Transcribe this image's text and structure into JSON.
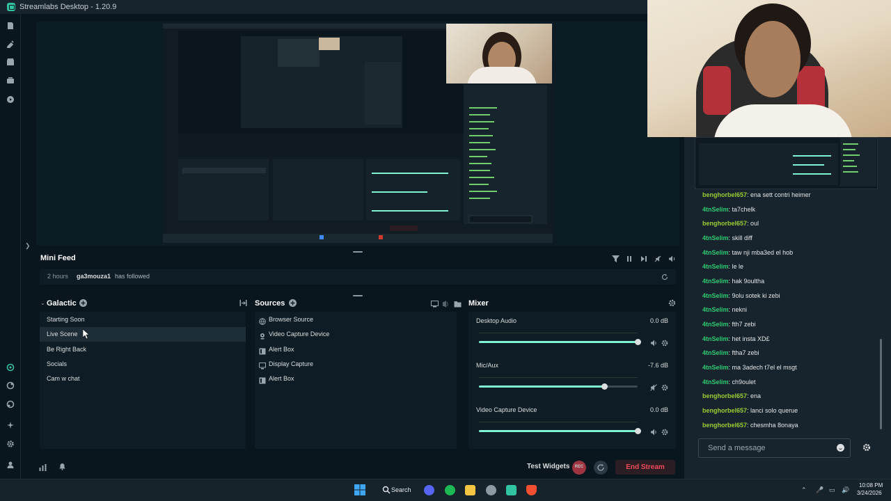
{
  "window": {
    "title": "Streamlabs Desktop - 1.20.9"
  },
  "minifeed": {
    "title": "Mini Feed",
    "events": [
      {
        "time": "2 hours",
        "user": "ga3mouza1",
        "action": "has followed"
      }
    ]
  },
  "scenes": {
    "title": "Galactic",
    "items": [
      "Starting Soon",
      "Live Scene",
      "Be Right Back",
      "Socials",
      "Cam w chat"
    ],
    "active_index": 1
  },
  "sources": {
    "title": "Sources",
    "items": [
      {
        "label": "Browser Source",
        "icon": "globe-icon"
      },
      {
        "label": "Video Capture Device",
        "icon": "camera-icon"
      },
      {
        "label": "Alert Box",
        "icon": "alert-box-icon"
      },
      {
        "label": "Display Capture",
        "icon": "monitor-icon"
      },
      {
        "label": "Alert Box",
        "icon": "alert-box-icon"
      }
    ]
  },
  "mixer": {
    "title": "Mixer",
    "channels": [
      {
        "name": "Desktop Audio",
        "db": "0.0 dB",
        "level": 1.0,
        "muted": false
      },
      {
        "name": "Mic/Aux",
        "db": "-7.6 dB",
        "level": 0.79,
        "muted": true
      },
      {
        "name": "Video Capture Device",
        "db": "0.0 dB",
        "level": 1.0,
        "muted": false
      }
    ]
  },
  "footer": {
    "test_widgets": "Test Widgets",
    "rec_label": "REC",
    "end_stream": "End Stream"
  },
  "chat": {
    "input_placeholder": "Send a message",
    "colors": {
      "benghorbel657": "#9acd32",
      "4tnSelim": "#2ecc71"
    },
    "messages": [
      {
        "user": "benghorbel657",
        "text": "ena sett contri heimer"
      },
      {
        "user": "4tnSelim",
        "text": "ta7chelk"
      },
      {
        "user": "benghorbel657",
        "text": "oul"
      },
      {
        "user": "4tnSelim",
        "text": "skill diff"
      },
      {
        "user": "4tnSelim",
        "text": "taw nji mba3ed el hob"
      },
      {
        "user": "4tnSelim",
        "text": "le le"
      },
      {
        "user": "4tnSelim",
        "text": "hak 9oultha"
      },
      {
        "user": "4tnSelim",
        "text": "9olu sotek ki zebi"
      },
      {
        "user": "4tnSelim",
        "text": "nekni"
      },
      {
        "user": "4tnSelim",
        "text": "fth7 zebi"
      },
      {
        "user": "4tnSelim",
        "text": "het insta XD£"
      },
      {
        "user": "4tnSelim",
        "text": "ftha7 zebi"
      },
      {
        "user": "4tnSelim",
        "text": "ma 3adech t7el el msgt"
      },
      {
        "user": "4tnSelim",
        "text": "ch9oulet"
      },
      {
        "user": "benghorbel657",
        "text": "ena"
      },
      {
        "user": "benghorbel657",
        "text": "lanci solo querue"
      },
      {
        "user": "benghorbel657",
        "text": "chesmha 8onaya"
      }
    ]
  },
  "taskbar": {
    "search_label": "Search",
    "time": "10:08 PM",
    "date": "3/24/2026"
  },
  "theme": {
    "accent": "#80f5d2",
    "background": "#09161d",
    "panel": "#17242d",
    "danger": "#f24b59"
  }
}
